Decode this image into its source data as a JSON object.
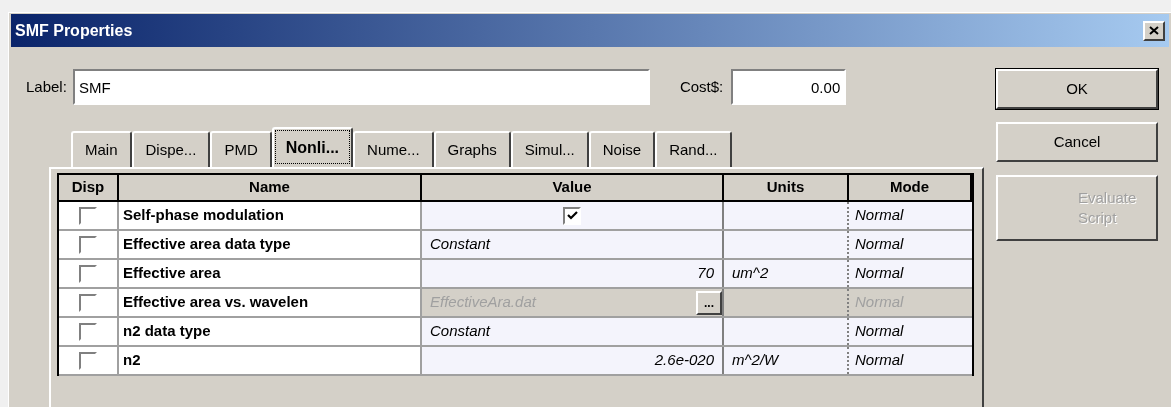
{
  "window": {
    "title": "SMF Properties"
  },
  "label_field": {
    "label": "Label:",
    "value": "SMF"
  },
  "cost_field": {
    "label": "Cost$:",
    "value": "0.00"
  },
  "buttons": [
    {
      "label": "OK",
      "default": true,
      "disabled": false
    },
    {
      "label": "Cancel",
      "default": false,
      "disabled": false
    },
    {
      "label": "Evaluate Script",
      "default": false,
      "disabled": true
    }
  ],
  "tabs": [
    {
      "label": "Main",
      "selected": false
    },
    {
      "label": "Dispe...",
      "selected": false
    },
    {
      "label": "PMD",
      "selected": false
    },
    {
      "label": "Nonli...",
      "selected": true
    },
    {
      "label": "Nume...",
      "selected": false
    },
    {
      "label": "Graphs",
      "selected": false
    },
    {
      "label": "Simul...",
      "selected": false
    },
    {
      "label": "Noise",
      "selected": false
    },
    {
      "label": "Rand...",
      "selected": false
    }
  ],
  "table": {
    "columns": [
      "Disp",
      "Name",
      "Value",
      "Units",
      "Mode"
    ],
    "rows": [
      {
        "disp_checked": false,
        "name": "Self-phase modulation",
        "kind": "checkbox",
        "checked": true,
        "mode": "Normal",
        "disabled": false
      },
      {
        "disp_checked": false,
        "name": "Effective area data type",
        "kind": "text",
        "value": "Constant",
        "mode": "Normal",
        "disabled": false
      },
      {
        "disp_checked": false,
        "name": "Effective area",
        "kind": "number",
        "value": "70",
        "units": "um^2",
        "mode": "Normal",
        "disabled": false
      },
      {
        "disp_checked": false,
        "name": "Effective area vs. wavelen",
        "kind": "file",
        "value": "EffectiveAra.dat",
        "button": "...",
        "mode": "Normal",
        "disabled": true
      },
      {
        "disp_checked": false,
        "name": "n2 data type",
        "kind": "text",
        "value": "Constant",
        "mode": "Normal",
        "disabled": false
      },
      {
        "disp_checked": false,
        "name": "n2",
        "kind": "number",
        "value": "2.6e-020",
        "units": "m^2/W",
        "mode": "Normal",
        "disabled": false
      }
    ]
  }
}
